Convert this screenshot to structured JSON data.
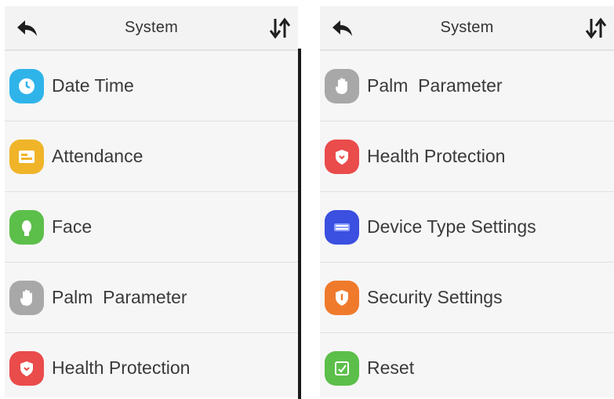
{
  "left": {
    "title": "System",
    "items": [
      {
        "label": "Date Time",
        "icon": "clock-icon",
        "color": "#2fb4ea"
      },
      {
        "label": "Attendance",
        "icon": "attendance-card-icon",
        "color": "#f0b429"
      },
      {
        "label": "Face",
        "icon": "face-icon",
        "color": "#5cbf4a"
      },
      {
        "label": "Palm  Parameter",
        "icon": "palm-icon",
        "color": "#a8a8a8"
      },
      {
        "label": "Health Protection",
        "icon": "shield-icon",
        "color": "#ea4b4b"
      }
    ]
  },
  "right": {
    "title": "System",
    "items": [
      {
        "label": "Palm  Parameter",
        "icon": "palm-icon",
        "color": "#a8a8a8"
      },
      {
        "label": "Health Protection",
        "icon": "shield-icon",
        "color": "#ea4b4b"
      },
      {
        "label": "Device Type Settings",
        "icon": "keyboard-icon",
        "color": "#3b4fe0"
      },
      {
        "label": "Security Settings",
        "icon": "security-shield-icon",
        "color": "#f07a2c"
      },
      {
        "label": "Reset",
        "icon": "reset-icon",
        "color": "#5cbf4a"
      }
    ]
  }
}
